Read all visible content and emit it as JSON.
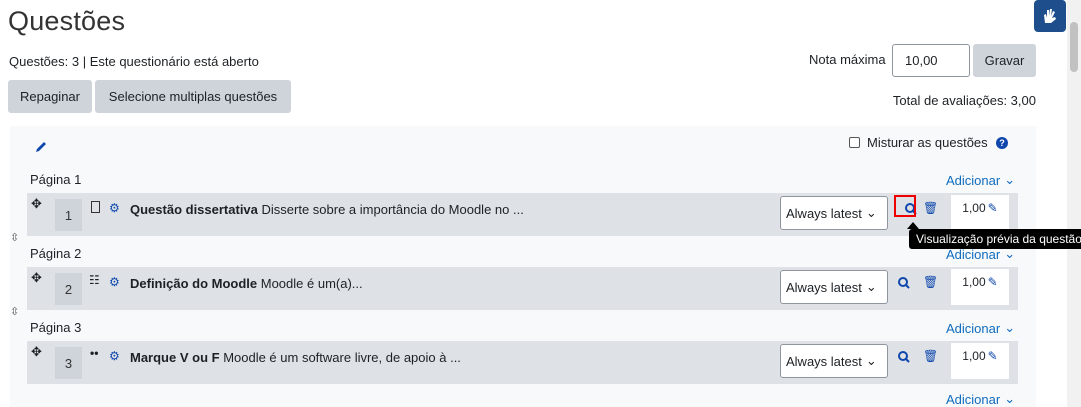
{
  "header": {
    "title": "Questões",
    "info": "Questões: 3 | Este questionário está aberto",
    "max_grade_label": "Nota máxima",
    "max_grade_value": "10,00",
    "save_label": "Gravar",
    "repaginate_label": "Repaginar",
    "select_multiple_label": "Selecione multiplas questões",
    "total_marks": "Total de avaliações: 3,00"
  },
  "shuffle_label": "Misturar as questões",
  "add_label": "Adicionar",
  "pages": [
    {
      "label": "Página 1"
    },
    {
      "label": "Página 2"
    },
    {
      "label": "Página 3"
    }
  ],
  "questions": [
    {
      "number": "1",
      "type_icon": "essay-icon",
      "title": "Questão dissertativa",
      "text": "Disserte sobre a importância do Moodle no ...",
      "version": "Always latest",
      "mark": "1,00"
    },
    {
      "number": "2",
      "type_icon": "matching-icon",
      "title": "Definição do Moodle",
      "text": "Moodle é um(a)...",
      "version": "Always latest",
      "mark": "1,00"
    },
    {
      "number": "3",
      "type_icon": "truefalse-icon",
      "title": "Marque V ou F",
      "text": "Moodle é um software livre, de apoio à ...",
      "version": "Always latest",
      "mark": "1,00"
    }
  ],
  "tooltip": "Visualização prévia da questão",
  "colors": {
    "link": "#0f6cbf",
    "icon": "#0f47ad",
    "highlight": "#e00000"
  }
}
